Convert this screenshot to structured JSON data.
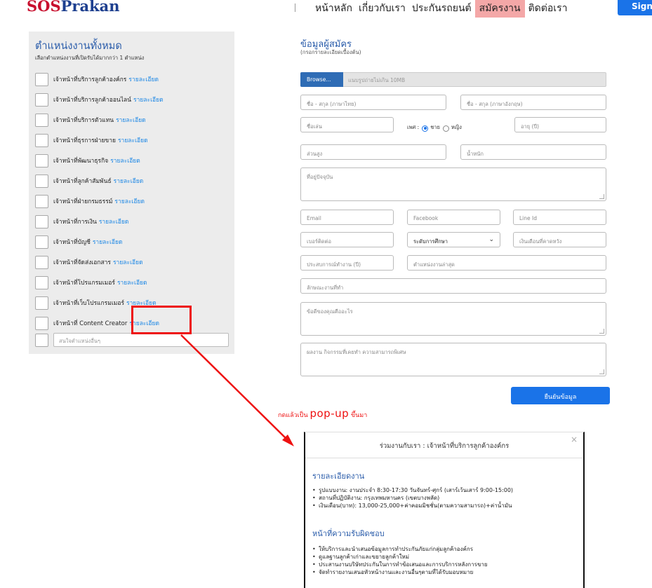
{
  "header": {
    "logo_a": "SOS",
    "logo_b": "Prakan",
    "nav": [
      "หน้าหลัก",
      "เกี่ยวกับเรา",
      "ประกันรถยนต์",
      "สมัครงาน",
      "ติดต่อเรา"
    ],
    "nav_active_index": 3,
    "signin_label": "Sign"
  },
  "positions": {
    "title": "ตำแหน่งงานทั้งหมด",
    "subtitle": "เลือกตำแหน่งงานที่เปิดรับได้มากกว่า 1 ตำแหน่ง",
    "detail_link": "รายละเอียด",
    "items": [
      "เจ้าหน้าที่บริการลูกค้าองค์กร",
      "เจ้าหน้าที่บริการลูกค้าออนไลน์",
      "เจ้าหน้าที่บริการตัวแทน",
      "เจ้าหน้าที่ธุรการฝ่ายขาย",
      "เจ้าหน้าที่พัฒนาธุรกิจ",
      "เจ้าหน้าที่ลูกค้าสัมพันธ์",
      "เจ้าหน้าที่ฝ่ายกรมธรรม์",
      "เจ้าหน้าที่การเงิน",
      "เจ้าหน้าที่บัญชี",
      "เจ้าหน้าที่จัดส่งเอกสาร",
      "เจ้าหน้าที่โปรแกรมเมอร์",
      "เจ้าหน้าที่เว็บโปรแกรมเมอร์",
      "เจ้าหน้าที่ Content Creator"
    ],
    "other_placeholder": "สนใจตำแหน่งอื่นๆ"
  },
  "form": {
    "title": "ข้อมูลผู้สมัคร",
    "subtitle": "(กรอกรายละเอียดเบื้องต้น)",
    "browse_label": "Browse...",
    "file_hint": "แนบรูปถ่ายไม่เกิน 10MB",
    "name_th": "ชื่อ - สกุล (ภาษาไทย)",
    "name_en": "ชื่อ - สกุล (ภาษาอังกฤษ)",
    "nickname": "ชื่อเล่น",
    "gender_label": "เพศ :",
    "gender_male": "ชาย",
    "gender_female": "หญิง",
    "age": "อายุ (ปี)",
    "height": "ส่วนสูง",
    "weight": "น้ำหนัก",
    "address": "ที่อยู่ปัจจุบัน",
    "email": "Email",
    "facebook": "Facebook",
    "line_id": "Line Id",
    "phone": "เบอร์ติดต่อ",
    "education_selected": "ระดับการศึกษา",
    "expected_salary": "เงินเดือนที่คาดหวัง",
    "experience": "ประสบการณ์ทำงาน (ปี)",
    "last_position": "ตำแหน่งงานล่าสุด",
    "job_type": "ลักษณะงานที่ทำ",
    "strengths": "ข้อดีของคุณคืออะไร",
    "achievements": "ผลงาน กิจกรรมที่เคยทำ ความสามารถพิเศษ",
    "submit_label": "ยืนยันข้อมูล"
  },
  "annotation": {
    "text_a": "กดแล้วเป็น ",
    "text_big": "pop-up",
    "text_b": " ขึ้นมา",
    "color": "#e11111"
  },
  "modal": {
    "title": "ร่วมงานกับเรา : เจ้าหน้าที่บริการลูกค้าองค์กร",
    "close": "×",
    "section1": "รายละเอียดงาน",
    "details": [
      "รูปแบบงาน: งานประจำ 8:30-17:30 วันจันทร์-ศุกร์ (เสาร์เว้นเสาร์ 9:00-15:00)",
      "สถานที่ปฏิบัติงาน: กรุงเทพมหานคร (เขตบางพลัด)",
      "เงินเดือน(บาท): 13,000-25,000+ค่าคอมมิชชั่น(ตามความสามารถ)+ค่าน้ำมัน"
    ],
    "section2": "หน้าที่ความรับผิดชอบ",
    "duties": [
      "ให้บริการและนำเสนอข้อมูลการทำประกันภัยแก่กลุ่มลูกค้าองค์กร",
      "ดูแลฐานลูกค้าเก่าและขยายลูกค้าใหม่",
      "ประสานงานบริษัทประกันในการทำข้อเสนอและการบริการหลังการขาย",
      "จัดทำรายงานเสนอหัวหน้างานและงานอื่นๆตามที่ได้รับมอบหมาย"
    ]
  },
  "colors": {
    "brand_red": "#c8102e",
    "brand_blue": "#1d3f8f",
    "accent": "#1a73e8",
    "title_blue": "#2a5caa",
    "link": "#1e88e5"
  }
}
